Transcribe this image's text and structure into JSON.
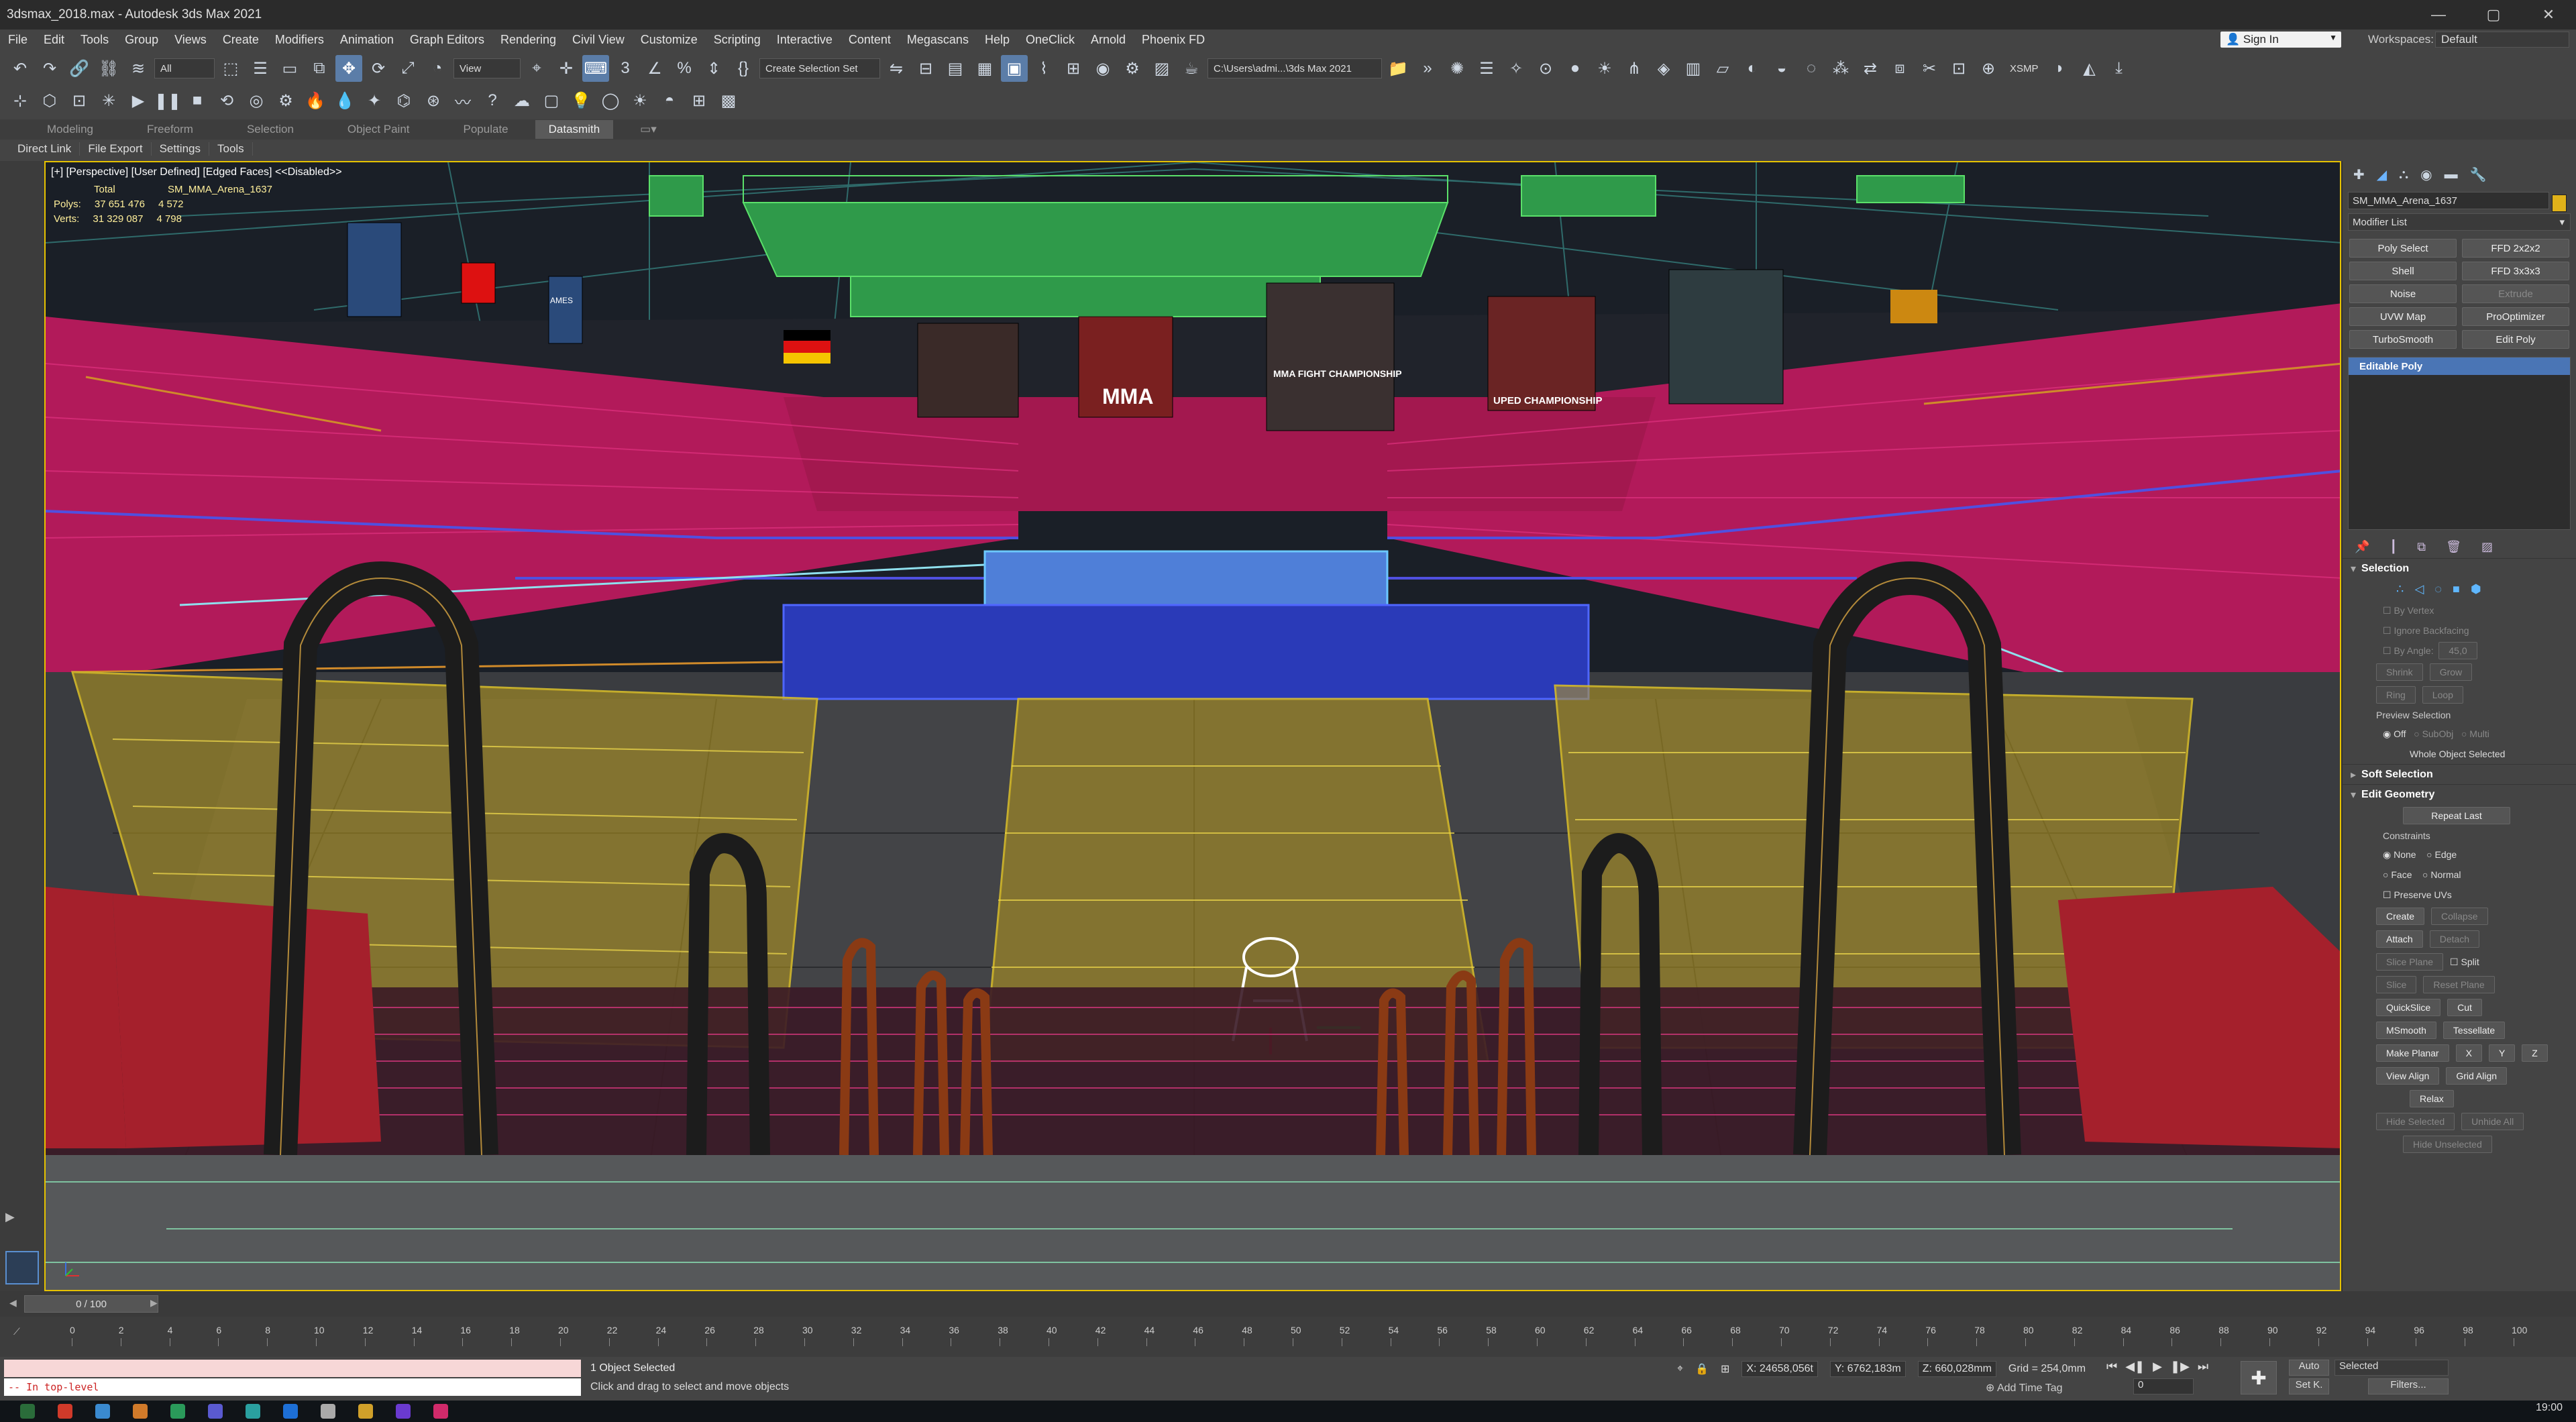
{
  "window": {
    "title": "3dsmax_2018.max - Autodesk 3ds Max 2021",
    "controls": [
      "—",
      "▢",
      "✕"
    ]
  },
  "menu": [
    "File",
    "Edit",
    "Tools",
    "Group",
    "Views",
    "Create",
    "Modifiers",
    "Animation",
    "Graph Editors",
    "Rendering",
    "Civil View",
    "Customize",
    "Scripting",
    "Interactive",
    "Content",
    "Megascans",
    "Help",
    "OneClick",
    "Arnold",
    "Phoenix FD"
  ],
  "account": {
    "sign_in": "Sign In",
    "workspaces_label": "Workspaces:",
    "workspace_value": "Default"
  },
  "toolbar1": {
    "filter": "All",
    "ref_coord": "View",
    "selection_set": "Create Selection Set",
    "project_path": "C:\\Users\\admi...\\3ds Max 2021",
    "xsmp": "XSMP"
  },
  "ribbon": {
    "tabs": [
      "Modeling",
      "Freeform",
      "Selection",
      "Object Paint",
      "Populate",
      "Datasmith"
    ],
    "active": "Datasmith"
  },
  "datasmith": [
    "Direct Link",
    "File Export",
    "Settings",
    "Tools"
  ],
  "viewport": {
    "label": "[+] [Perspective] [User Defined] [Edged Faces] <<Disabled>>",
    "stats": {
      "total_label": "Total",
      "object_name": "SM_MMA_Arena_1637",
      "polys_label": "Polys:",
      "polys_total": "37 651 476",
      "polys_obj": "4 572",
      "verts_label": "Verts:",
      "verts_total": "31 329 087",
      "verts_obj": "4 798"
    },
    "banner_texts": [
      "MMA",
      "MMA FIGHT CHAMPIONSHIP",
      "UPED CHAMPIONSHIP",
      "AMES"
    ]
  },
  "command_panel": {
    "object_name": "SM_MMA_Arena_1637",
    "modifier_list": "Modifier List",
    "modifier_buttons": [
      "Poly Select",
      "FFD 2x2x2",
      "Shell",
      "FFD 3x3x3",
      "Noise",
      "Extrude",
      "UVW Map",
      "ProOptimizer",
      "TurboSmooth",
      "Edit Poly"
    ],
    "stack_item": "Editable Poly",
    "selection": {
      "title": "Selection",
      "by_vertex": "By Vertex",
      "ignore_backfacing": "Ignore Backfacing",
      "by_angle": "By Angle:",
      "angle_value": "45,0",
      "shrink": "Shrink",
      "grow": "Grow",
      "ring": "Ring",
      "loop": "Loop",
      "preview_selection": "Preview Selection",
      "preview_off": "Off",
      "preview_subobj": "SubObj",
      "preview_multi": "Multi",
      "whole_object": "Whole Object Selected"
    },
    "soft_selection": "Soft Selection",
    "edit_geometry": {
      "title": "Edit Geometry",
      "repeat_last": "Repeat Last",
      "constraints": "Constraints",
      "none": "None",
      "edge": "Edge",
      "face": "Face",
      "normal": "Normal",
      "preserve_uvs": "Preserve UVs",
      "create": "Create",
      "collapse": "Collapse",
      "attach": "Attach",
      "detach": "Detach",
      "slice_plane": "Slice Plane",
      "split": "Split",
      "slice": "Slice",
      "reset_plane": "Reset Plane",
      "quickslice": "QuickSlice",
      "cut": "Cut",
      "msmooth": "MSmooth",
      "tessellate": "Tessellate",
      "make_planar": "Make Planar",
      "x": "X",
      "y": "Y",
      "z": "Z",
      "view_align": "View Align",
      "grid_align": "Grid Align",
      "relax": "Relax",
      "hide_selected": "Hide Selected",
      "unhide_all": "Unhide All",
      "hide_unselected": "Hide Unselected"
    }
  },
  "timeline": {
    "slider": "0 / 100",
    "ticks": [
      "0",
      "2",
      "4",
      "6",
      "8",
      "10",
      "12",
      "14",
      "16",
      "18",
      "20",
      "22",
      "24",
      "26",
      "28",
      "30",
      "32",
      "34",
      "36",
      "38",
      "40",
      "42",
      "44",
      "46",
      "48",
      "50",
      "52",
      "54",
      "56",
      "58",
      "60",
      "62",
      "64",
      "66",
      "68",
      "70",
      "72",
      "74",
      "76",
      "78",
      "80",
      "82",
      "84",
      "86",
      "88",
      "90",
      "92",
      "94",
      "96",
      "98",
      "100"
    ]
  },
  "status": {
    "maxscript_output": "-- In top-level",
    "selection": "1 Object Selected",
    "hint": "Click and drag to select and move objects",
    "x": "X: 24658,056t",
    "y": "Y: 6762,183m",
    "z": "Z: 660,028mm",
    "grid": "Grid = 254,0mm",
    "add_time_tag": "Add Time Tag",
    "auto": "Auto",
    "set_k": "Set K.",
    "selected": "Selected",
    "filters": "Filters...",
    "frame": "0",
    "clock": "19:00"
  }
}
